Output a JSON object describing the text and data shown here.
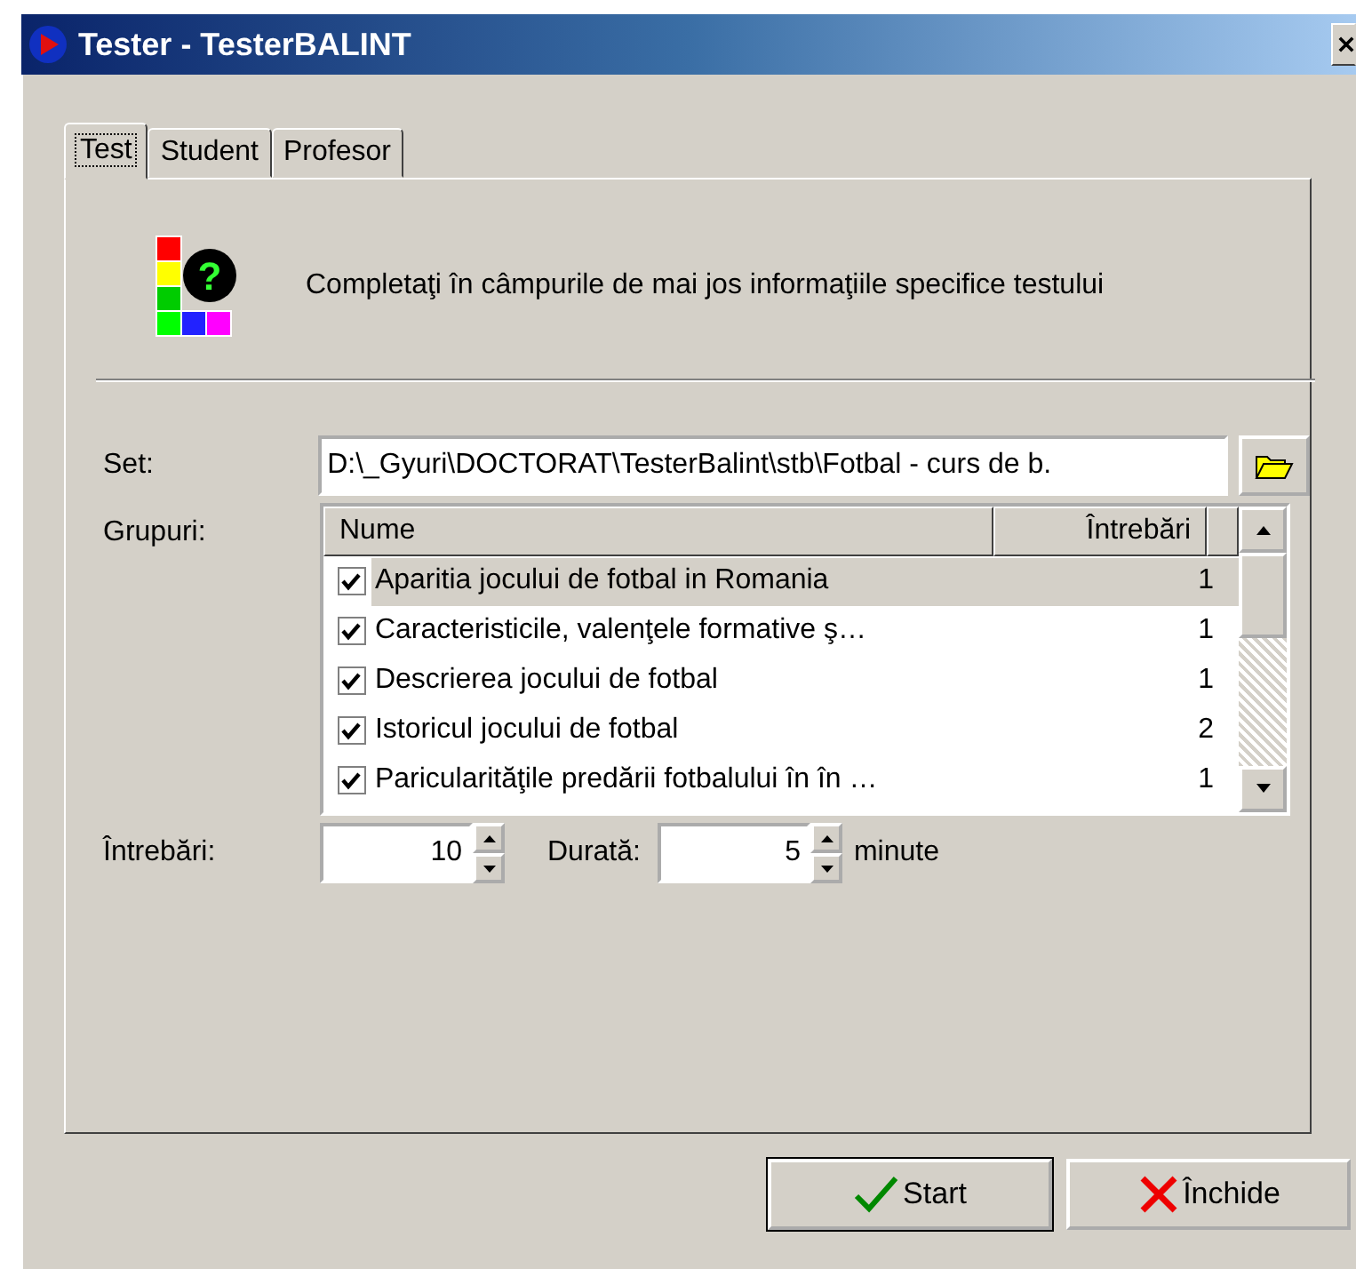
{
  "window": {
    "title": "Tester - TesterBALINT"
  },
  "tabs": [
    {
      "label": "Test",
      "selected": true
    },
    {
      "label": "Student",
      "selected": false
    },
    {
      "label": "Profesor",
      "selected": false
    }
  ],
  "info": {
    "icon_mark": "?",
    "text": "Completaţi în câmpurile de mai jos informaţiile specifice testului"
  },
  "set": {
    "label": "Set:",
    "value": "D:\\_Gyuri\\DOCTORAT\\TesterBalint\\stb\\Fotbal - curs de b."
  },
  "groups": {
    "label": "Grupuri:",
    "columns": [
      "Nume",
      "Întrebări"
    ],
    "rows": [
      {
        "name": "Aparitia jocului de fotbal in Romania",
        "count": "1",
        "checked": true,
        "selected": true
      },
      {
        "name": "Caracteristicile, valenţele formative ş…",
        "count": "1",
        "checked": true,
        "selected": false
      },
      {
        "name": "Descrierea jocului de fotbal",
        "count": "1",
        "checked": true,
        "selected": false
      },
      {
        "name": "Istoricul jocului de fotbal",
        "count": "2",
        "checked": true,
        "selected": false
      },
      {
        "name": "Paricularităţile predării fotbalului în în …",
        "count": "1",
        "checked": true,
        "selected": false
      }
    ]
  },
  "questions": {
    "label": "Întrebări:",
    "value": "10"
  },
  "duration": {
    "label": "Durată:",
    "value": "5",
    "unit": "minute"
  },
  "buttons": [
    {
      "kind": "start",
      "label": "Start",
      "default": true
    },
    {
      "kind": "close",
      "label": "Închide",
      "default": false
    }
  ]
}
